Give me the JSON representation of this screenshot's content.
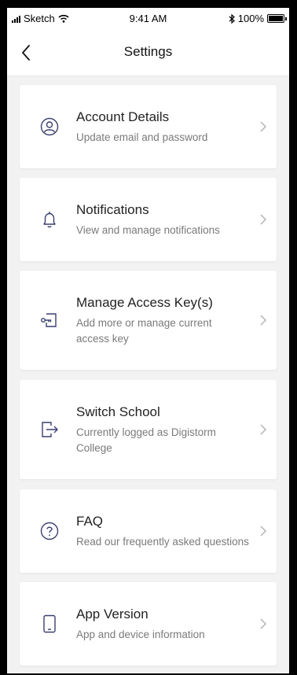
{
  "status_bar": {
    "carrier": "Sketch",
    "time": "9:41 AM",
    "battery": "100%"
  },
  "nav": {
    "title": "Settings",
    "back_icon": "chevron-left-icon"
  },
  "items": [
    {
      "title": "Account Details",
      "subtitle": "Update email and password",
      "icon": "user-circle-icon"
    },
    {
      "title": "Notifications",
      "subtitle": "View and manage notifications",
      "icon": "bell-icon"
    },
    {
      "title": "Manage Access Key(s)",
      "subtitle": "Add more or manage current access key",
      "icon": "key-icon"
    },
    {
      "title": "Switch School",
      "subtitle": "Currently logged as Digistorm College",
      "icon": "logout-icon"
    },
    {
      "title": "FAQ",
      "subtitle": "Read our frequently asked questions",
      "icon": "question-circle-icon"
    },
    {
      "title": "App Version",
      "subtitle": "App and device information",
      "icon": "phone-icon"
    }
  ],
  "colors": {
    "icon": "#3a3f6e",
    "chevron": "#b0b0b0",
    "background": "#f2f2f2"
  }
}
